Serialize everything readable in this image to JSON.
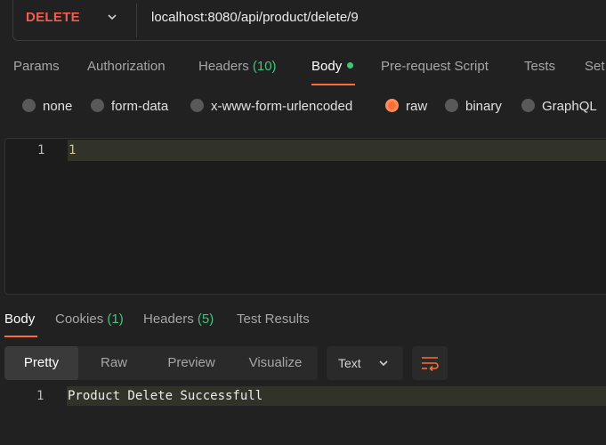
{
  "request": {
    "method": "DELETE",
    "url": "localhost:8080/api/product/delete/9"
  },
  "request_tabs": [
    {
      "label": "Params"
    },
    {
      "label": "Authorization"
    },
    {
      "label": "Headers",
      "count": "(10)"
    },
    {
      "label": "Body",
      "active": true
    },
    {
      "label": "Pre-request Script"
    },
    {
      "label": "Tests"
    },
    {
      "label": "Settings",
      "visible_text": "Set"
    }
  ],
  "body_types": [
    {
      "label": "none"
    },
    {
      "label": "form-data"
    },
    {
      "label": "x-www-form-urlencoded"
    },
    {
      "label": "raw",
      "selected": true
    },
    {
      "label": "binary"
    },
    {
      "label": "GraphQL"
    }
  ],
  "request_editor": {
    "line_number": "1",
    "content": "1"
  },
  "response_tabs": [
    {
      "label": "Body",
      "active": true
    },
    {
      "label": "Cookies",
      "count": "(1)"
    },
    {
      "label": "Headers",
      "count": "(5)"
    },
    {
      "label": "Test Results"
    }
  ],
  "response_format": {
    "modes": [
      "Pretty",
      "Raw",
      "Preview",
      "Visualize"
    ],
    "active_mode": "Pretty",
    "language": "Text"
  },
  "response_body": {
    "line_number": "1",
    "content": "Product Delete Successfull"
  },
  "colors": {
    "accent": "#ff6c37",
    "method_delete": "#f15b50",
    "count_green": "#45c37a",
    "background": "#212121"
  },
  "icons": [
    "chevron-down-icon",
    "wrap-lines-icon"
  ]
}
